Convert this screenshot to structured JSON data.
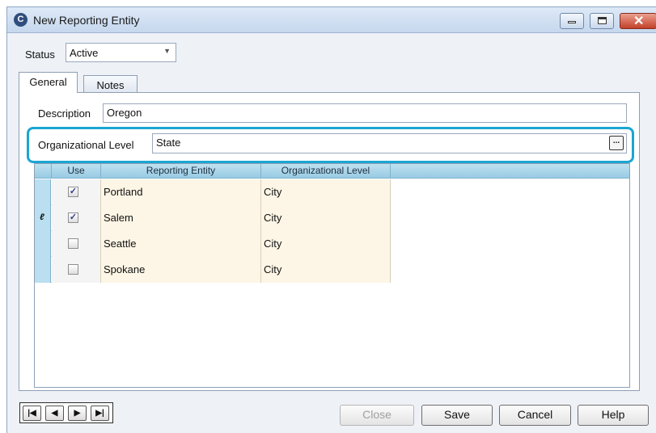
{
  "window": {
    "title": "New Reporting Entity",
    "icon": "app-logo-icon"
  },
  "status": {
    "label": "Status",
    "value": "Active"
  },
  "tabs": [
    {
      "label": "General",
      "selected": true
    },
    {
      "label": "Notes",
      "selected": false
    }
  ],
  "form": {
    "description_label": "Description",
    "description_value": "Oregon",
    "org_level_label": "Organizational Level",
    "org_level_value": "State",
    "browse_button": "..."
  },
  "highlight_color": "#1aa6d2",
  "grid": {
    "columns": [
      "Use",
      "Reporting Entity",
      "Organizational Level"
    ],
    "rows": [
      {
        "use": true,
        "entity": "Portland",
        "level": "City",
        "editing": false
      },
      {
        "use": true,
        "entity": "Salem",
        "level": "City",
        "editing": true
      },
      {
        "use": false,
        "entity": "Seattle",
        "level": "City",
        "editing": false
      },
      {
        "use": false,
        "entity": "Spokane",
        "level": "City",
        "editing": false
      }
    ]
  },
  "navigator": {
    "first": "first-record-icon",
    "prev": "prev-record-icon",
    "next": "next-record-icon",
    "last": "last-record-icon"
  },
  "buttons": {
    "close": "Close",
    "save": "Save",
    "cancel": "Cancel",
    "help": "Help"
  }
}
